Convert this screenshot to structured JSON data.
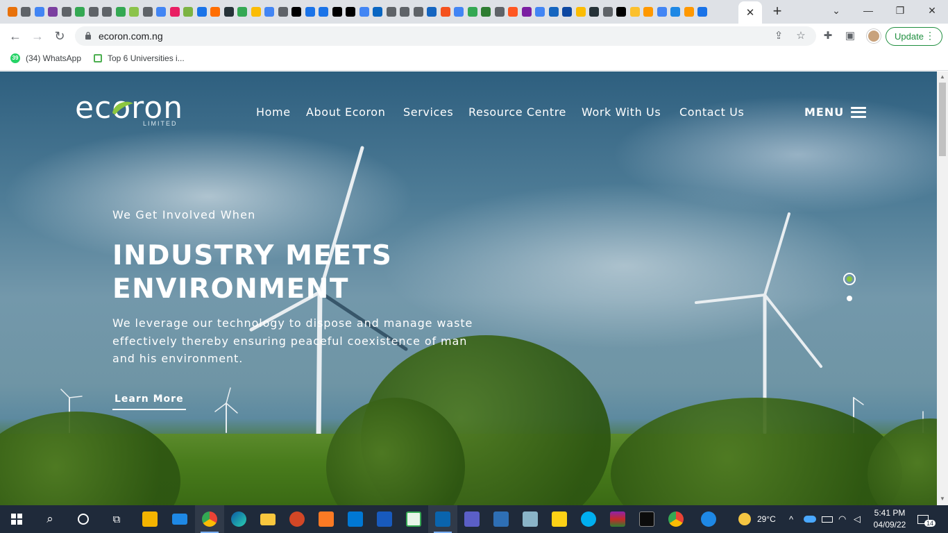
{
  "browser": {
    "active_tab_close": "✕",
    "new_tab": "+",
    "url": "ecoron.com.ng",
    "update_label": "Update",
    "bookmarks": [
      {
        "label": "(34) WhatsApp",
        "badge": "39"
      },
      {
        "label": "Top 6 Universities i..."
      }
    ],
    "tab_favicon_colors": [
      "#e8710a",
      "#5f6368",
      "#4285f4",
      "#7b3fa0",
      "#5f6368",
      "#34a853",
      "#5f6368",
      "#5f6368",
      "#34a853",
      "#8bc34a",
      "#5f6368",
      "#4285f4",
      "#e91e63",
      "#7cb342",
      "#1a73e8",
      "#ff6d00",
      "#263238",
      "#34a853",
      "#fbbc04",
      "#4285f4",
      "#5f6368",
      "#000000",
      "#1a73e8",
      "#1a73e8",
      "#000000",
      "#000000",
      "#4285f4",
      "#0a66c2",
      "#5f6368",
      "#5f6368",
      "#5f6368",
      "#1565c0",
      "#f4511e",
      "#4285f4",
      "#34a853",
      "#2e7d32",
      "#5f6368",
      "#ff5722",
      "#7b1fa2",
      "#4285f4",
      "#1565c0",
      "#0d47a1",
      "#fbbc04",
      "#263238",
      "#5f6368",
      "#000000",
      "#fbc02d",
      "#ff9800",
      "#4285f4",
      "#1e88e5",
      "#ff9800",
      "#1a73e8"
    ]
  },
  "site": {
    "logo_text": "ecoron",
    "logo_sub": "LIMITED",
    "nav": [
      "Home",
      "About Ecoron",
      "Services",
      "Resource Centre",
      "Work With Us",
      "Contact Us"
    ],
    "menu_label": "MENU",
    "hero": {
      "eyebrow": "We Get Involved When",
      "headline_line1": "INDUSTRY MEETS",
      "headline_line2": "ENVIRONMENT",
      "lead": "We leverage our technology to dispose and manage waste effectively thereby ensuring peaceful coexistence of man and his environment.",
      "cta": "Learn More"
    },
    "slider_dots": 2,
    "accent": "#8cc63f"
  },
  "taskbar": {
    "weather": "29°C",
    "time": "5:41 PM",
    "date": "04/09/22",
    "notifications": "14"
  }
}
